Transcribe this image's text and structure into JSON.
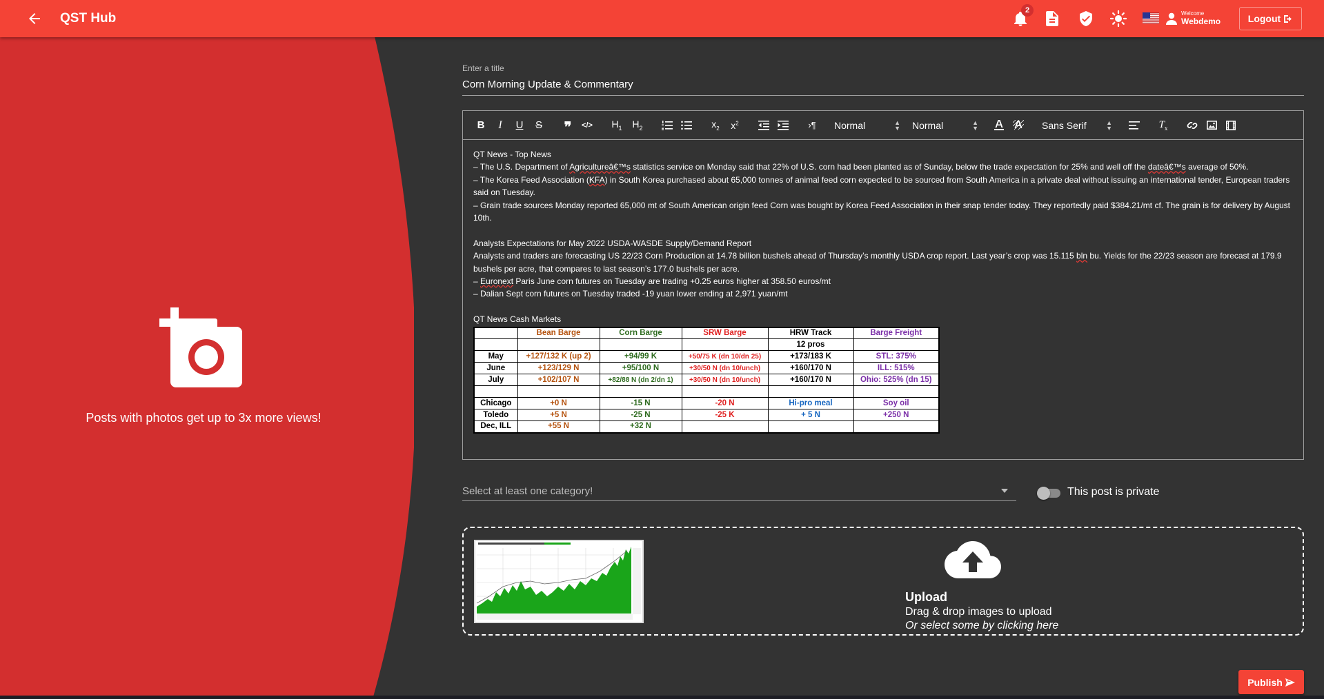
{
  "header": {
    "app_title": "QST Hub",
    "notification_count": "2",
    "welcome_label": "Welcome",
    "username": "Webdemo",
    "logout_label": "Logout",
    "icons": [
      "back-arrow-icon",
      "bell-icon",
      "document-icon",
      "shield-check-icon",
      "sun-icon",
      "us-flag-icon",
      "user-icon",
      "logout-icon"
    ]
  },
  "left_panel": {
    "promo_text": "Posts with photos get up to 3x more views!",
    "color": "#d32f2f"
  },
  "post": {
    "title_label": "Enter a title",
    "title_value": "Corn Morning Update & Commentary"
  },
  "toolbar": {
    "header_select": "Normal",
    "size_select": "Normal",
    "font_select": "Sans Serif"
  },
  "content": {
    "heading1": "QT News - Top News",
    "p1_a": "– The U.S. Department of ",
    "p1_b": "Agricultureâ€™s",
    "p1_c": " statistics service on Monday said that 22% of U.S. corn had been planted as of Sunday, below the trade expectation for 25% and well off the ",
    "p1_d": "dateâ€™s",
    "p1_e": " average of 50%.",
    "p2_a": "– The Korea Feed Association (",
    "p2_b": "KFA",
    "p2_c": ") in South Korea purchased about 65,000 tonnes of animal feed corn expected to be sourced from South America in a private deal without issuing an international tender, European traders said on Tuesday.",
    "p3": "– Grain trade sources Monday reported 65,000 mt of South American origin feed Corn was bought by Korea Feed Association in their snap tender today. They reportedly paid $384.21/mt cf. The grain is for delivery by August 10th.",
    "heading2": "Analysts Expectations for May 2022 USDA-WASDE Supply/Demand Report",
    "p4_a": "Analysts and traders are forecasting US 22/23 Corn Production at 14.78 billion bushels ahead of Thursday’s monthly USDA crop report. Last year’s crop was 15.115 ",
    "p4_b": "bln",
    "p4_c": " bu. Yields for the 22/23 season are forecast at 179.9 bushels per acre, that compares to last season’s 177.0 bushels per acre.",
    "p5_a": "– ",
    "p5_b": "Euronext",
    "p5_c": " Paris June corn futures on Tuesday are trading +0.25 euros higher at 358.50 euros/mt",
    "p6": "– Dalian Sept corn futures on Tuesday traded -19 yuan lower ending at 2,971 yuan/mt",
    "heading3": "QT News Cash Markets"
  },
  "cash_table": {
    "column_colors": [
      "#000000",
      "#b5530f",
      "#2e6b1f",
      "#e02020",
      "#000000",
      "#7b2fa8"
    ],
    "header": [
      "",
      "Bean Barge",
      "Corn Barge",
      "SRW Barge",
      "HRW Track",
      "Barge Freight"
    ],
    "rows": [
      [
        "",
        "",
        "",
        "",
        "12 pros",
        ""
      ],
      [
        "May",
        "+127/132 K (up 2)",
        "+94/99 K",
        "+50/75 K (dn 10/dn 25)",
        "+173/183 K",
        "STL: 375%"
      ],
      [
        "June",
        "+123/129 N",
        "+95/100 N",
        "+30/50 N (dn 10/unch)",
        "+160/170 N",
        "ILL: 515%"
      ],
      [
        "July",
        "+102/107 N",
        "+82/88 N (dn 2/dn 1)",
        "+30/50 N (dn 10/unch)",
        "+160/170 N",
        "Ohio: 525% (dn 15)"
      ],
      [
        "",
        "",
        "",
        "",
        "",
        ""
      ],
      [
        "Chicago",
        "+0 N",
        "-15 N",
        "-20 N",
        "Hi-pro meal",
        "Soy oil"
      ],
      [
        "Toledo",
        "+5 N",
        "-25 N",
        "-25 K",
        "+ 5 N",
        "+250 N"
      ],
      [
        "Dec, ILL",
        "+55 N",
        "+32 N",
        "",
        "",
        ""
      ]
    ]
  },
  "category": {
    "placeholder": "Select at least one category!"
  },
  "privacy": {
    "label": "This post is private",
    "enabled": false
  },
  "upload": {
    "title": "Upload",
    "line1": "Drag & drop images to upload",
    "line2": "Or select some by clicking here"
  },
  "publish_label": "Publish",
  "colors": {
    "primary": "#f44336",
    "panel_red": "#d32f2f",
    "background": "#333333",
    "chart_green": "#1aa51a"
  }
}
